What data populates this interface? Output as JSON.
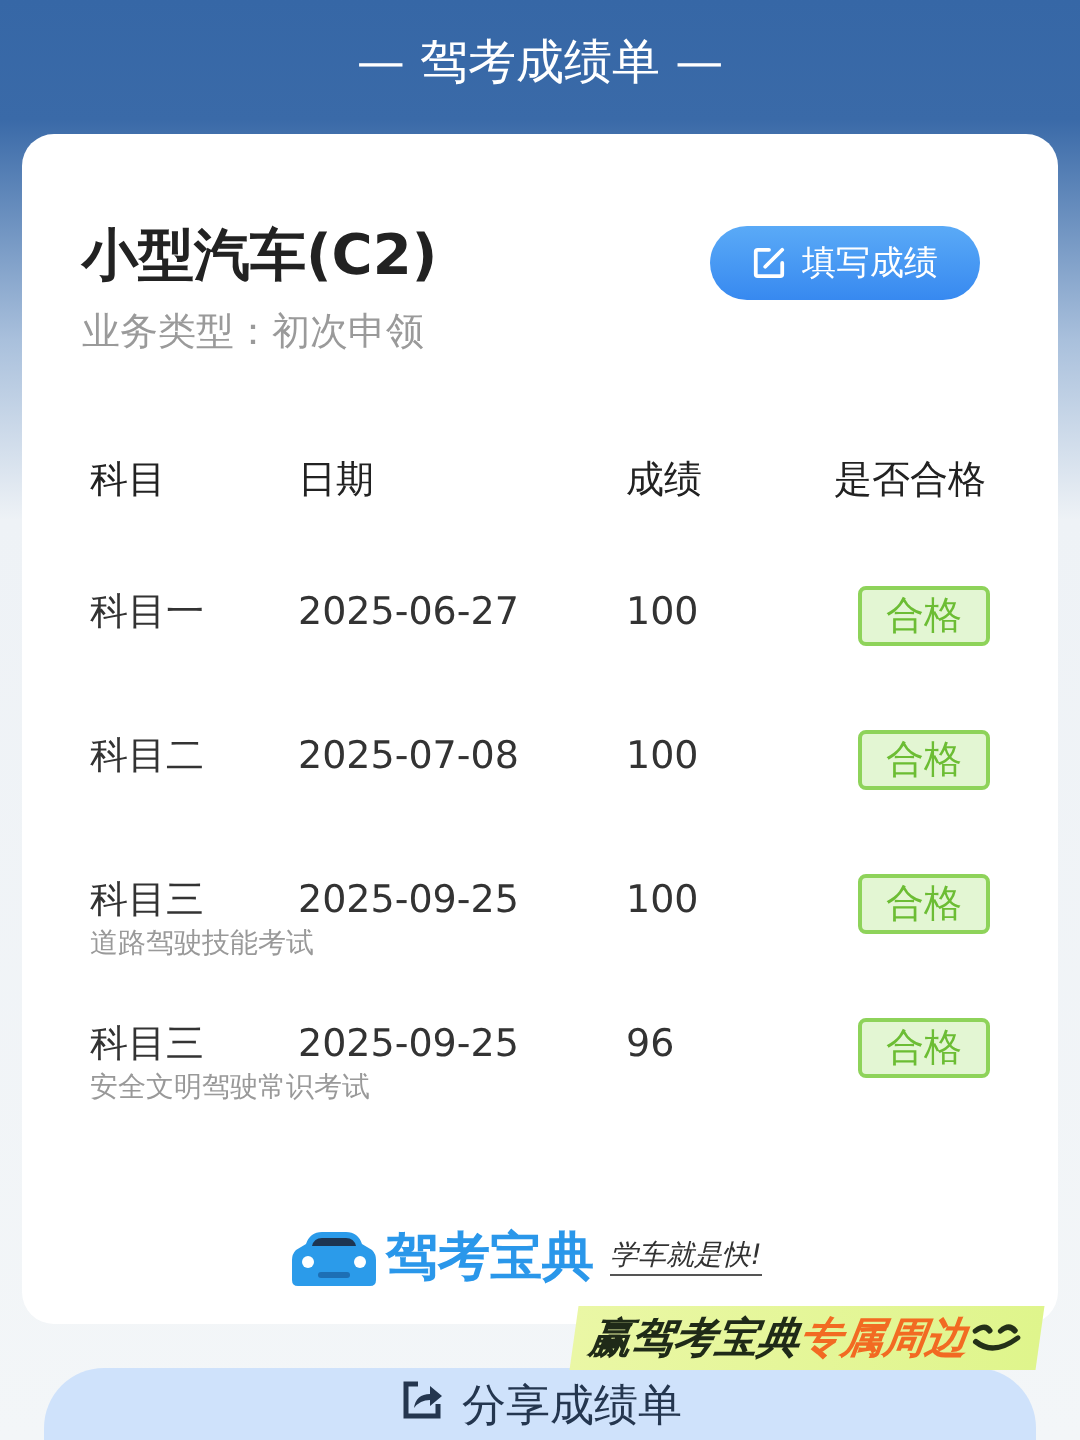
{
  "header": {
    "title": "— 驾考成绩单 —"
  },
  "license": {
    "name": "小型汽车(C2)",
    "business_type": "业务类型：初次申领",
    "edit_button": "填写成绩"
  },
  "table": {
    "columns": [
      "科目",
      "日期",
      "成绩",
      "是否合格"
    ],
    "rows": [
      {
        "subject": "科目一",
        "date": "2025-06-27",
        "score": "100",
        "result": "合格",
        "passed": true
      },
      {
        "subject": "科目二",
        "date": "2025-07-08",
        "score": "100",
        "result": "合格",
        "passed": true
      },
      {
        "subject": "科目三",
        "note": "道路驾驶技能考试",
        "date": "2025-09-25",
        "score": "100",
        "result": "合格",
        "passed": true
      },
      {
        "subject": "科目三",
        "note": "安全文明驾驶常识考试",
        "date": "2025-09-25",
        "score": "96",
        "result": "合格",
        "passed": true
      }
    ]
  },
  "brand": {
    "name": "驾考宝典",
    "slogan": "学车就是快!"
  },
  "promo": {
    "text": "赢驾考宝典",
    "highlight": "专属周边"
  },
  "share_button": "分享成绩单"
}
